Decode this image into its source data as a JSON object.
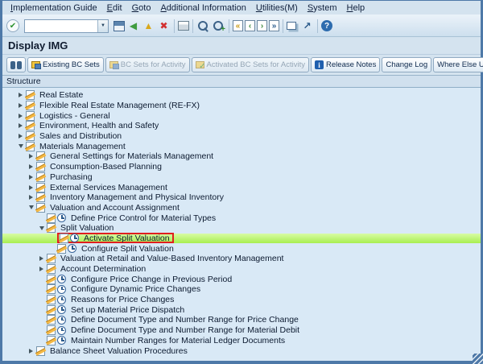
{
  "window": {
    "title": "Display IMG",
    "frame_color": "#4e79a8"
  },
  "menubar": {
    "items": [
      "Implementation Guide",
      "Edit",
      "Goto",
      "Additional Information",
      "Utilities(M)",
      "System",
      "Help"
    ]
  },
  "toolbar": {
    "left_icons": [
      "enter-icon"
    ],
    "command_field": {
      "value": ""
    },
    "icons": [
      "save-icon",
      "back-icon",
      "exit-icon",
      "cancel-icon",
      "sep",
      "print-icon",
      "sep",
      "find-icon",
      "find-next-icon",
      "sep",
      "first-page-icon",
      "prev-page-icon",
      "next-page-icon",
      "last-page-icon",
      "sep",
      "new-session-icon",
      "shortcut-icon",
      "sep",
      "help-icon"
    ]
  },
  "app_toolbar": {
    "buttons": [
      {
        "label": "",
        "name": "find-button",
        "icon": "binoculars-icon",
        "enabled": true
      },
      {
        "label": "Existing BC Sets",
        "icon": "bc-set-icon",
        "enabled": true
      },
      {
        "label": "BC Sets for Activity",
        "icon": "bc-set-icon",
        "enabled": false
      },
      {
        "label": "Activated BC Sets for Activity",
        "icon": "activated-bc-set-icon",
        "enabled": false
      },
      {
        "label": "Release Notes",
        "icon": "release-notes-icon",
        "enabled": true
      },
      {
        "label": "Change Log",
        "enabled": true
      },
      {
        "label": "Where Else Used",
        "enabled": true
      }
    ]
  },
  "structure": {
    "label": "Structure"
  },
  "tree": {
    "rows": [
      {
        "label": "Real Estate",
        "level": 0,
        "type": "folder",
        "state": "collapsed"
      },
      {
        "label": "Flexible Real Estate Management (RE-FX)",
        "level": 0,
        "type": "folder",
        "state": "collapsed"
      },
      {
        "label": "Logistics - General",
        "level": 0,
        "type": "folder",
        "state": "collapsed"
      },
      {
        "label": "Environment, Health and Safety",
        "level": 0,
        "type": "folder",
        "state": "collapsed"
      },
      {
        "label": "Sales and Distribution",
        "level": 0,
        "type": "folder",
        "state": "collapsed"
      },
      {
        "label": "Materials Management",
        "level": 0,
        "type": "folder",
        "state": "expanded"
      },
      {
        "label": "General Settings for Materials Management",
        "level": 1,
        "type": "folder",
        "state": "collapsed"
      },
      {
        "label": "Consumption-Based Planning",
        "level": 1,
        "type": "folder",
        "state": "collapsed"
      },
      {
        "label": "Purchasing",
        "level": 1,
        "type": "folder",
        "state": "collapsed"
      },
      {
        "label": "External Services Management",
        "level": 1,
        "type": "folder",
        "state": "collapsed"
      },
      {
        "label": "Inventory Management and Physical Inventory",
        "level": 1,
        "type": "folder",
        "state": "collapsed"
      },
      {
        "label": "Valuation and Account Assignment",
        "level": 1,
        "type": "folder",
        "state": "expanded"
      },
      {
        "label": "Define Price Control for Material Types",
        "level": 2,
        "type": "activity"
      },
      {
        "label": "Split Valuation",
        "level": 2,
        "type": "folder",
        "state": "expanded"
      },
      {
        "label": "Activate Split Valuation",
        "level": 3,
        "type": "activity",
        "highlighted": true,
        "selected": true
      },
      {
        "label": "Configure Split Valuation",
        "level": 3,
        "type": "activity"
      },
      {
        "label": "Valuation at Retail and Value-Based Inventory Management",
        "level": 2,
        "type": "folder",
        "state": "collapsed"
      },
      {
        "label": "Account Determination",
        "level": 2,
        "type": "folder",
        "state": "collapsed"
      },
      {
        "label": "Configure Price Change in Previous Period",
        "level": 2,
        "type": "activity"
      },
      {
        "label": "Configure Dynamic Price Changes",
        "level": 2,
        "type": "activity"
      },
      {
        "label": "Reasons for Price Changes",
        "level": 2,
        "type": "activity"
      },
      {
        "label": "Set up Material Price Dispatch",
        "level": 2,
        "type": "activity"
      },
      {
        "label": "Define Document Type and Number Range for Price Change",
        "level": 2,
        "type": "activity"
      },
      {
        "label": "Define Document Type and Number Range for Material Debit",
        "level": 2,
        "type": "activity"
      },
      {
        "label": "Maintain Number Ranges for Material Ledger Documents",
        "level": 2,
        "type": "activity"
      },
      {
        "label": "Balance Sheet Valuation Procedures",
        "level": 1,
        "type": "folder",
        "state": "collapsed"
      }
    ]
  },
  "colors": {
    "highlight_row": "#b0f25c",
    "selection_box": "#e01f1f",
    "tree_background": "#d9e9f6"
  }
}
